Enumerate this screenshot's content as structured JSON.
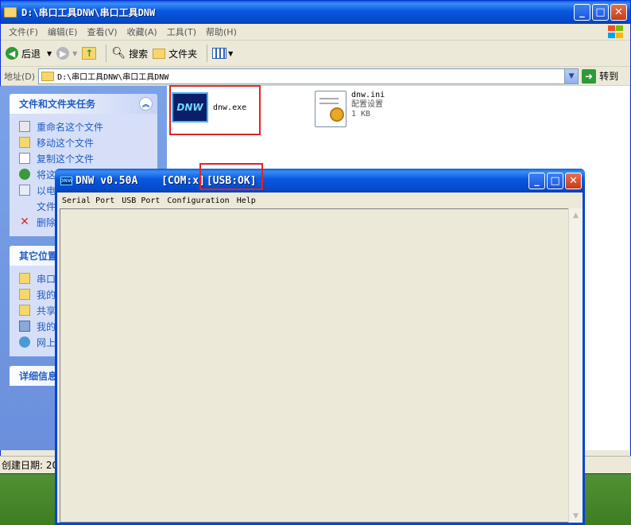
{
  "explorer": {
    "title": "D:\\串口工具DNW\\串口工具DNW",
    "menu": [
      "文件(F)",
      "编辑(E)",
      "查看(V)",
      "收藏(A)",
      "工具(T)",
      "帮助(H)"
    ],
    "toolbar": {
      "back": "后退",
      "search": "搜索",
      "folders": "文件夹"
    },
    "address": {
      "label": "地址(D)",
      "value": "D:\\串口工具DNW\\串口工具DNW",
      "go": "转到"
    },
    "tasks_panel": {
      "header": "文件和文件夹任务",
      "items": [
        "重命名这个文件",
        "移动这个文件",
        "复制这个文件",
        "将这",
        "以电",
        "文件",
        "删除"
      ]
    },
    "places_panel": {
      "header": "其它位置",
      "items": [
        "串口",
        "我的",
        "共享",
        "我的",
        "网上"
      ]
    },
    "details_panel": {
      "header": "详细信息"
    },
    "files": [
      {
        "name": "dnw.exe",
        "icon_text": "DNW"
      },
      {
        "name": "dnw.ini",
        "type": "配置设置",
        "size": "1 KB"
      }
    ],
    "status": "创建日期: 20"
  },
  "dnw": {
    "title_app": "DNW v0.50A",
    "title_com": "[COM:x]",
    "title_usb": "[USB:OK]",
    "icon_text": "DNW",
    "menu": [
      "Serial Port",
      "USB Port",
      "Configuration",
      "Help"
    ]
  },
  "colors": {
    "highlight": "#e02424",
    "xp_blue": "#0548c6",
    "task_link": "#215dc6"
  }
}
